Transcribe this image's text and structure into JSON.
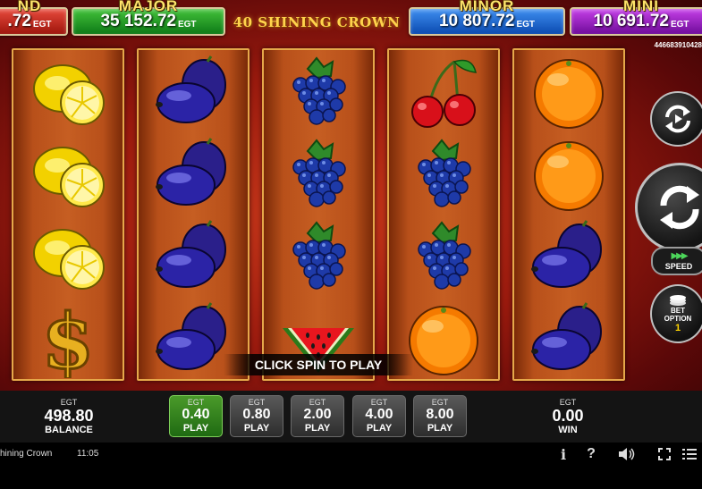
{
  "jackpots": {
    "grand": {
      "title": "ND",
      "value": ".72",
      "unit": "EGT"
    },
    "major": {
      "title": "MAJOR",
      "value": "35 152.72",
      "unit": "EGT"
    },
    "minor": {
      "title": "MINOR",
      "value": "10 807.72",
      "unit": "EGT"
    },
    "mini": {
      "title": "MINI",
      "value": "10 691.72",
      "unit": "EGT"
    }
  },
  "game_title": "40 SHINING CROWN",
  "session_id": "446683910428",
  "reels": [
    [
      "lemon",
      "lemon",
      "lemon",
      "dollar"
    ],
    [
      "plum",
      "plum",
      "plum",
      "plum"
    ],
    [
      "grapes",
      "grapes",
      "grapes",
      "watermelon"
    ],
    [
      "cherries",
      "grapes",
      "grapes",
      "orange"
    ],
    [
      "orange",
      "orange",
      "plum",
      "plum"
    ]
  ],
  "prompt": "CLICK SPIN TO PLAY",
  "buttons": {
    "autoplay_icon": "autoplay-icon",
    "spin_icon": "spin-icon",
    "speed_label": "SPEED",
    "bet_option_label_1": "BET",
    "bet_option_label_2": "OPTION",
    "bet_option_value": "1"
  },
  "balance": {
    "currency": "EGT",
    "value": "498.80",
    "label": "BALANCE"
  },
  "win": {
    "currency": "EGT",
    "value": "0.00",
    "label": "WIN"
  },
  "bets": [
    {
      "currency": "EGT",
      "value": "0.40",
      "label": "PLAY",
      "active": true
    },
    {
      "currency": "EGT",
      "value": "0.80",
      "label": "PLAY",
      "active": false
    },
    {
      "currency": "EGT",
      "value": "2.00",
      "label": "PLAY",
      "active": false
    },
    {
      "currency": "EGT",
      "value": "4.00",
      "label": "PLAY",
      "active": false
    },
    {
      "currency": "EGT",
      "value": "8.00",
      "label": "PLAY",
      "active": false
    }
  ],
  "system_bar": {
    "title": "hining Crown",
    "time": "11:05",
    "info_icon": "i",
    "help_icon": "?",
    "sound_icon": "sound-icon",
    "fullscreen_icon": "fullscreen-icon",
    "menu_icon": "menu-icon"
  }
}
